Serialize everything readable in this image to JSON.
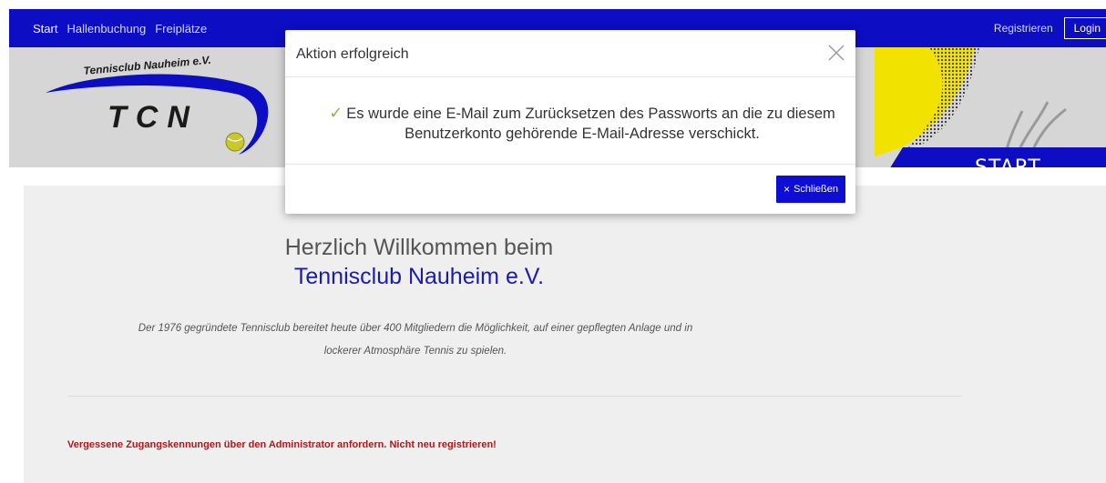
{
  "nav": {
    "items": [
      {
        "label": "Start"
      },
      {
        "label": "Hallenbuchung"
      },
      {
        "label": "Freiplätze"
      }
    ],
    "register_label": "Registrieren",
    "login_label": "Login"
  },
  "banner": {
    "logo_text_top": "Tennisclub Nauheim e.V.",
    "logo_text_main": "TCN",
    "page_title": "START"
  },
  "modal": {
    "title": "Aktion erfolgreich",
    "message_icon": "check-icon",
    "message": "Es wurde eine E-Mail zum Zurücksetzen des Passworts an die zu diesem Benutzerkonto gehörende E-Mail-Adresse verschickt.",
    "close_button_label": "Schließen"
  },
  "content": {
    "welcome_line1": "Herzlich Willkommen beim",
    "welcome_line2": "Tennisclub Nauheim e.V.",
    "intro_line1": "Der 1976 gegründete Tennisclub bereitet heute über 400 Mitgliedern die Möglichkeit, auf einer gepflegten Anlage und in",
    "intro_line2": "lockerer Atmosphäre Tennis zu spielen.",
    "warning": "Vergessene Zugangskennungen über den Administrator anfordern. Nicht neu registrieren!"
  },
  "colors": {
    "brand_blue": "#0d0dc4",
    "accent_yellow": "#f2e200",
    "warning_red": "#b4161b"
  }
}
